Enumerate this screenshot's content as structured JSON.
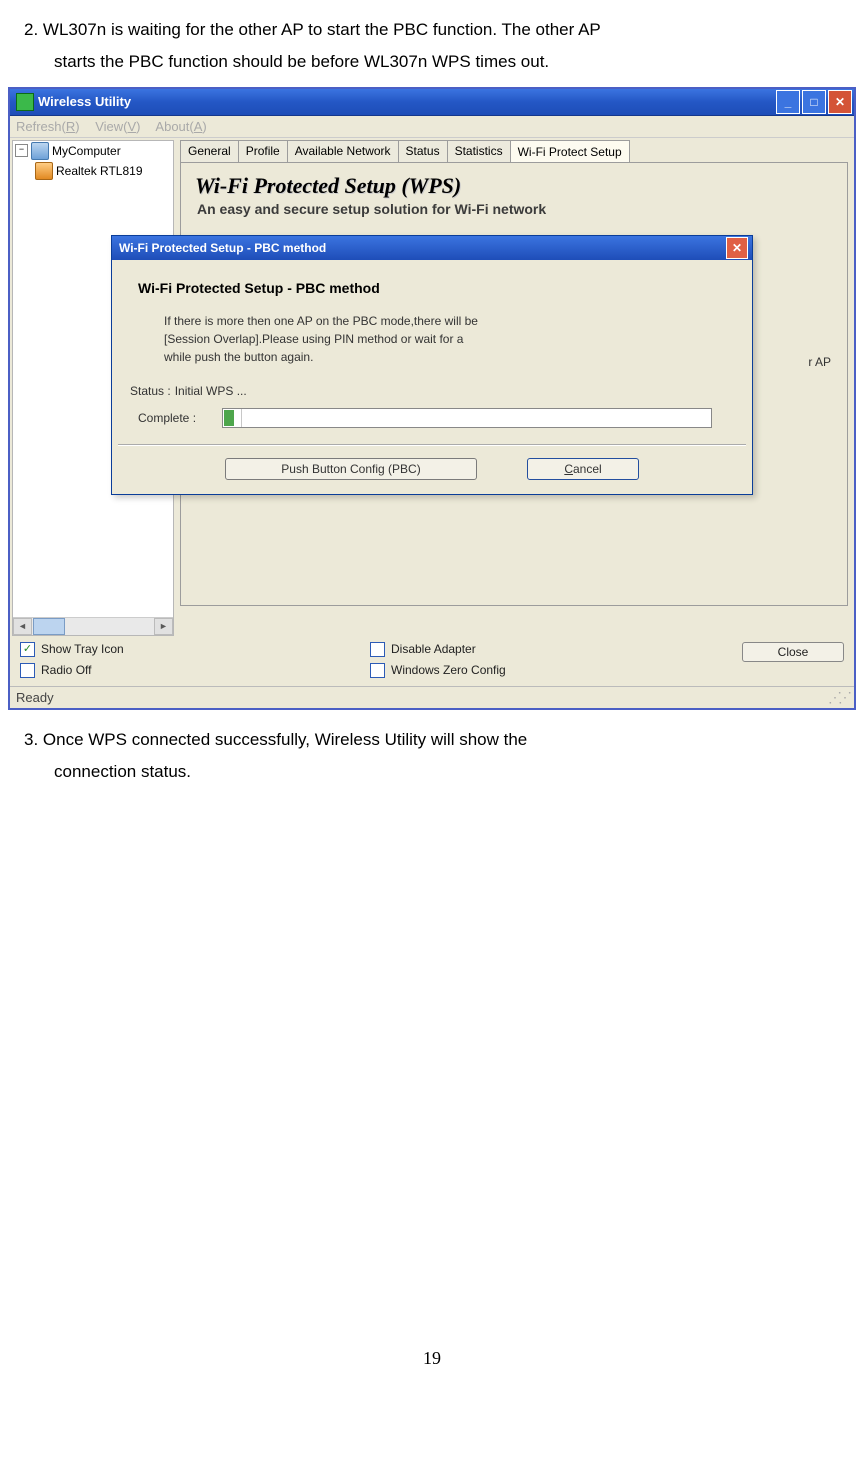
{
  "doc": {
    "step2_line1": "2. WL307n is waiting for the other AP to start the PBC function. The other AP",
    "step2_line2": "starts the PBC function should be before WL307n WPS times out.",
    "step3_line1": "3. Once WPS connected successfully, Wireless Utility will show the",
    "step3_line2": "connection status.",
    "page_num": "19"
  },
  "outer_window": {
    "title": "Wireless Utility",
    "menu": {
      "refresh": "Refresh(R)",
      "view": "View(V)",
      "about": "About(A)"
    },
    "tree": {
      "root": "MyComputer",
      "child": "Realtek RTL819"
    },
    "tabs": [
      "General",
      "Profile",
      "Available Network",
      "Status",
      "Statistics",
      "Wi-Fi Protect Setup"
    ],
    "wps_heading": "Wi-Fi Protected Setup (WPS)",
    "wps_sub": "An easy and secure setup solution for Wi-Fi network",
    "options": {
      "show_tray": "Show Tray Icon",
      "radio_off": "Radio Off",
      "disable": "Disable Adapter",
      "zero": "Windows Zero Config"
    },
    "close_btn": "Close",
    "status": "Ready",
    "ap_frag": "r AP"
  },
  "dialog": {
    "title": "Wi-Fi Protected Setup - PBC method",
    "heading": "Wi-Fi Protected Setup - PBC method",
    "body_l1": "If there is more then one AP on the PBC mode,there will be",
    "body_l2": "[Session Overlap].Please using PIN method or wait for a",
    "body_l3": "while push the button again.",
    "status_label": "Status :",
    "status_value": "Initial WPS ...",
    "complete_label": "Complete :",
    "pbc_btn": "Push Button Config (PBC)",
    "cancel_btn_u": "C",
    "cancel_btn_r": "ancel"
  }
}
